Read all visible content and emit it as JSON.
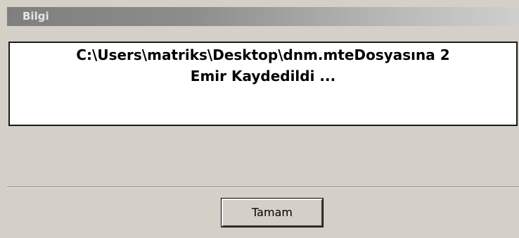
{
  "window": {
    "title": "Bilgi"
  },
  "message": {
    "line1": "C:\\Users\\matriks\\Desktop\\dnm.mteDosyasına 2",
    "line2": "Emir Kaydedildi ..."
  },
  "buttons": {
    "ok_label": "Tamam"
  },
  "colors": {
    "dialog_background": "#d4d0c8",
    "message_background": "#ffffff",
    "titlebar_start": "#7f7f7f",
    "titlebar_end": "#cfcfcf"
  }
}
